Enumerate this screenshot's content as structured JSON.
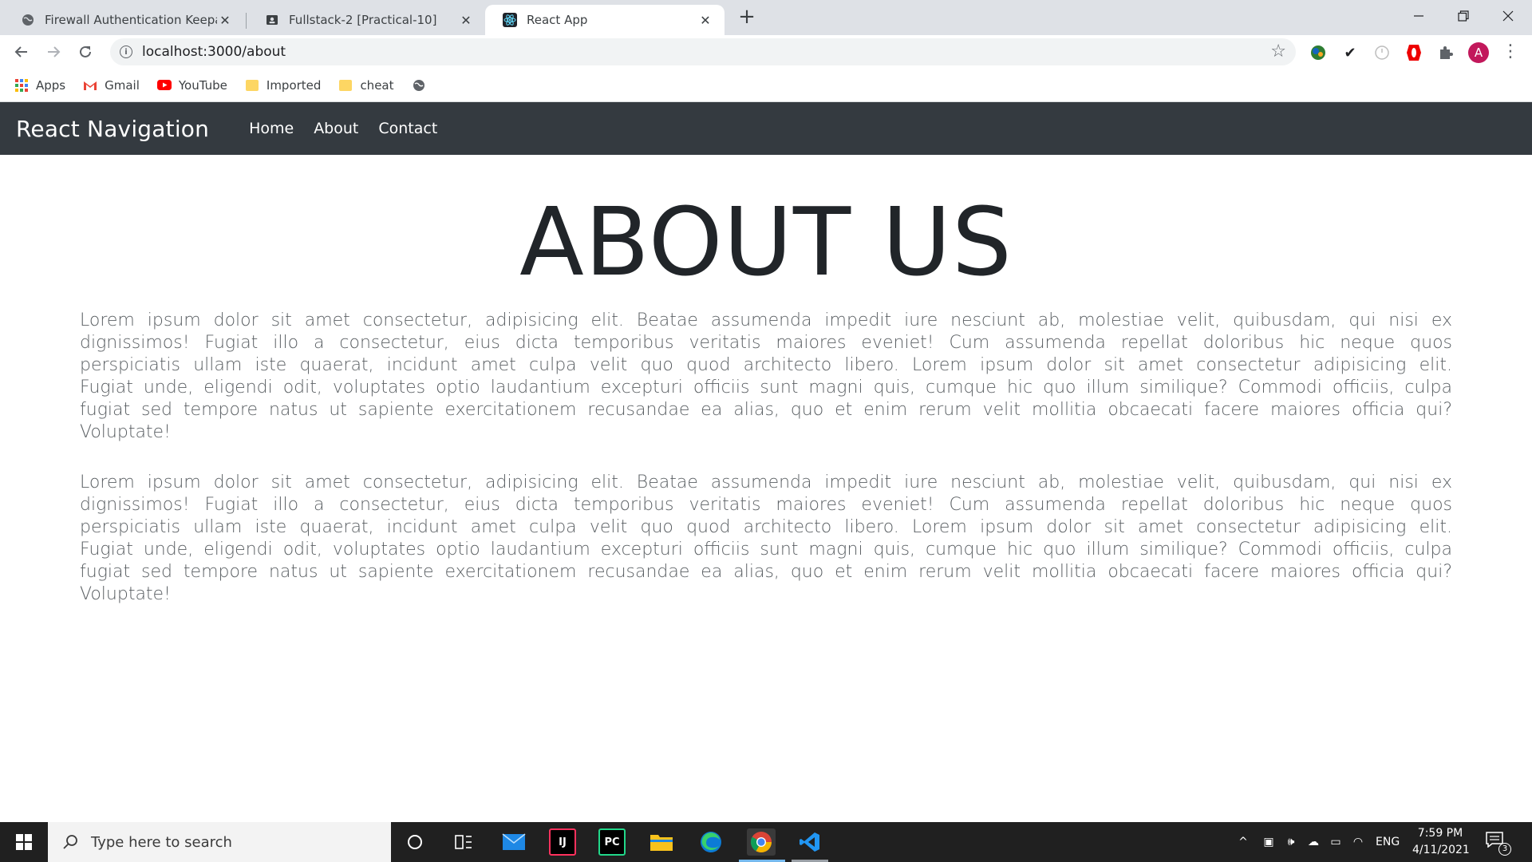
{
  "browser": {
    "tabs": [
      {
        "title": "Firewall Authentication Keepalive",
        "icon": "globe-icon"
      },
      {
        "title": "Fullstack-2 [Practical-10]",
        "icon": "contact-card-icon"
      },
      {
        "title": "React App",
        "icon": "react-icon"
      }
    ],
    "active_tab": 2,
    "url": "localhost:3000/about",
    "bookmarks": [
      {
        "label": "Apps",
        "icon": "apps-grid-icon"
      },
      {
        "label": "Gmail",
        "icon": "gmail-icon"
      },
      {
        "label": "YouTube",
        "icon": "youtube-icon"
      },
      {
        "label": "Imported",
        "icon": "folder-icon"
      },
      {
        "label": "cheat",
        "icon": "folder-icon"
      }
    ],
    "profile_initial": "A"
  },
  "app": {
    "brand": "React Navigation",
    "nav_links": [
      "Home",
      "About",
      "Contact"
    ],
    "heading": "ABOUT US",
    "paragraphs": [
      "Lorem ipsum dolor sit amet consectetur, adipisicing elit. Beatae assumenda impedit iure nesciunt ab, molestiae velit, quibusdam, qui nisi ex dignissimos! Fugiat illo a consectetur, eius dicta temporibus veritatis maiores eveniet! Cum assumenda repellat doloribus hic neque quos perspiciatis ullam iste quaerat, incidunt amet culpa velit quo quod architecto libero. Lorem ipsum dolor sit amet consectetur adipisicing elit. Fugiat unde, eligendi odit, voluptates optio laudantium excepturi officiis sunt magni quis, cumque hic quo illum similique? Commodi officiis, culpa fugiat sed tempore natus ut sapiente exercitationem recusandae ea alias, quo et enim rerum velit mollitia obcaecati facere maiores officia qui? Voluptate!",
      "Lorem ipsum dolor sit amet consectetur, adipisicing elit. Beatae assumenda impedit iure nesciunt ab, molestiae velit, quibusdam, qui nisi ex dignissimos! Fugiat illo a consectetur, eius dicta temporibus veritatis maiores eveniet! Cum assumenda repellat doloribus hic neque quos perspiciatis ullam iste quaerat, incidunt amet culpa velit quo quod architecto libero. Lorem ipsum dolor sit amet consectetur adipisicing elit. Fugiat unde, eligendi odit, voluptates optio laudantium excepturi officiis sunt magni quis, cumque hic quo illum similique? Commodi officiis, culpa fugiat sed tempore natus ut sapiente exercitationem recusandae ea alias, quo et enim rerum velit mollitia obcaecati facere maiores officia qui? Voluptate!"
    ]
  },
  "taskbar": {
    "search_placeholder": "Type here to search",
    "language": "ENG",
    "time": "7:59 PM",
    "date": "4/11/2021",
    "notification_count": "3"
  },
  "colors": {
    "navbar_bg": "#343a40",
    "heading_text": "#212529",
    "paragraph_text": "#5a5f63",
    "taskbar_bg": "#202020"
  }
}
